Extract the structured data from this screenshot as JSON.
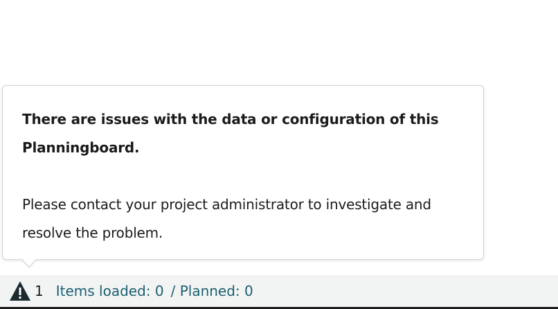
{
  "popover": {
    "title": "There are issues with the data or configuration of this Planningboard.",
    "body": "Please contact your project administrator to investigate and resolve the problem."
  },
  "status_bar": {
    "warning_icon": "warning-triangle-icon",
    "warning_count": "1",
    "items_loaded": "Items loaded: 0",
    "planned": "/ Planned: 0"
  },
  "colors": {
    "status_bar_bg": "#f2f4f4",
    "status_text": "#1b5e6e",
    "warning_icon": "#1b2b2f"
  }
}
